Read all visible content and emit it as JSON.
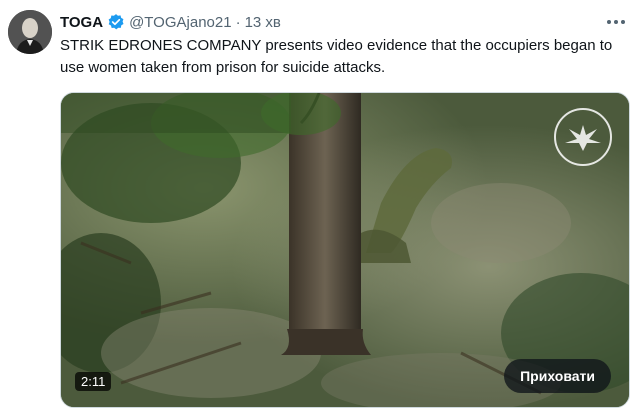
{
  "tweet": {
    "author_name": "TOGA",
    "handle": "@TOGAjano21",
    "separator": "·",
    "time": "13 хв",
    "text": "STRIK EDRONES COMPANY presents video evidence that the occupiers began to use women taken from prison for suicide attacks.",
    "verified_color": "#1d9bf0"
  },
  "media": {
    "duration": "2:11",
    "hide_label": "Приховати"
  },
  "icons": {
    "avatar": "profile-photo",
    "verified": "verified-badge-icon",
    "more": "more-options-icon",
    "watermark": "emblem-icon"
  }
}
